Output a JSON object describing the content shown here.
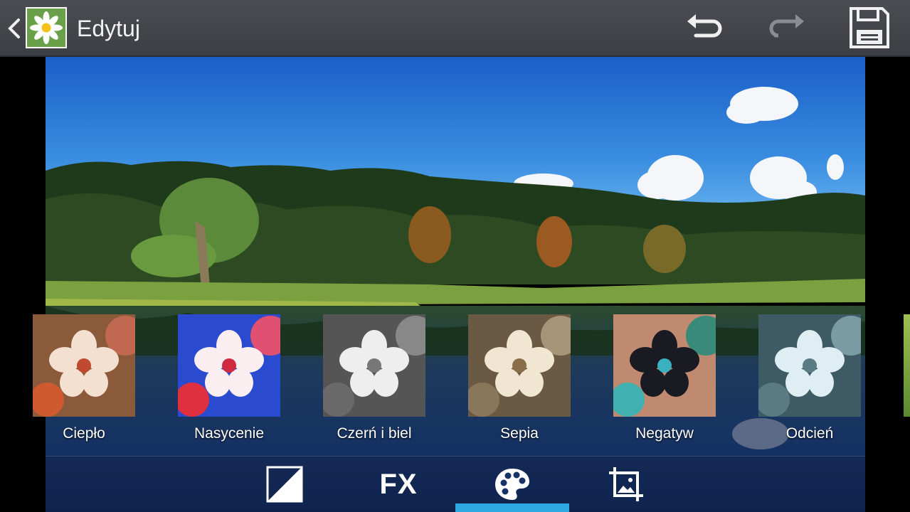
{
  "topbar": {
    "title": "Edytuj",
    "icons": {
      "back": "chevron-left-icon",
      "app": "gallery-flower-icon",
      "undo": "undo-icon",
      "redo": "redo-icon",
      "save": "save-icon"
    },
    "redo_enabled": false
  },
  "filters": [
    {
      "label": "Ciepło",
      "style": "warm"
    },
    {
      "label": "Nasycenie",
      "style": "saturated"
    },
    {
      "label": "Czerń i biel",
      "style": "bw"
    },
    {
      "label": "Sepia",
      "style": "sepia"
    },
    {
      "label": "Negatyw",
      "style": "negative"
    },
    {
      "label": "Odcień",
      "style": "tint"
    }
  ],
  "toolbar": {
    "tools": [
      {
        "name": "adjust-icon"
      },
      {
        "name": "fx-icon",
        "text": "FX"
      },
      {
        "name": "palette-icon",
        "selected": true
      },
      {
        "name": "crop-icon"
      }
    ]
  },
  "colors": {
    "accent": "#2ea8e0",
    "topbar": "#44474c"
  }
}
